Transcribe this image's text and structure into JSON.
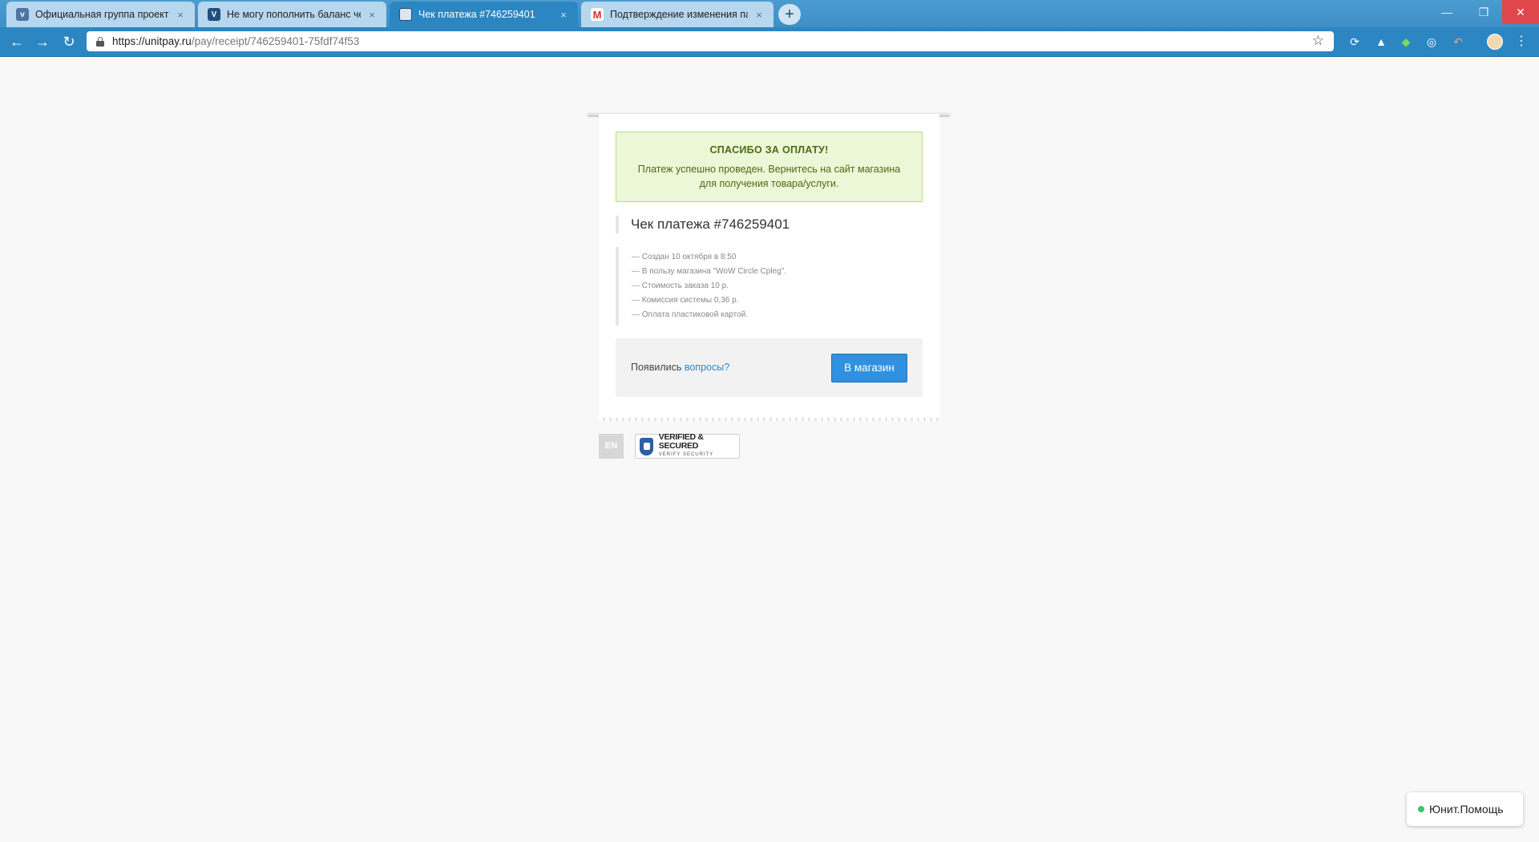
{
  "browser": {
    "tabs": [
      {
        "title": "Официальная группа проекта W",
        "favicon": "vk-icon",
        "favicon_color": "#4c75a3",
        "active": false
      },
      {
        "title": "Не могу пополнить баланс чере",
        "favicon": "forum-icon",
        "favicon_color": "#1f4f7c",
        "active": false
      },
      {
        "title": "Чек платежа #746259401",
        "favicon": "document-icon",
        "favicon_color": "#d9e6f2",
        "active": true
      },
      {
        "title": "Подтверждение изменения пар",
        "favicon": "gmail-icon",
        "favicon_color": "#d93025",
        "active": false
      }
    ],
    "tab_close_glyph": "×",
    "new_tab_glyph": "+",
    "address": {
      "host": "https://unitpay.ru",
      "path": "/pay/receipt/746259401-75fdf74f53"
    }
  },
  "receipt": {
    "success": {
      "title": "СПАСИБО ЗА ОПЛАТУ!",
      "text": "Платеж успешно проведен. Вернитесь на сайт магазина для получения товара/услуги."
    },
    "title": "Чек платежа #746259401",
    "details": [
      "Создан 10 октября в 8:50",
      "В пользу магазина \"WoW Circle Cpleg\".",
      "Стоимость заказа 10 р.",
      "Комиссия системы 0,36 р.",
      "Оплата пластиковой картой."
    ],
    "footer": {
      "question_prefix": "Появились",
      "question_link": "вопросы?",
      "store_button": "В магазин"
    }
  },
  "language_button": "EN",
  "security_badge": {
    "title": "VERIFIED & SECURED",
    "subtitle": "VERIFY SECURITY"
  },
  "help_widget": {
    "label": "Юнит.Помощь",
    "status_color": "#3ec36b"
  },
  "colors": {
    "chrome": "#2c86c2",
    "success_bg": "#ebf7d6",
    "button": "#2f91e0",
    "link": "#2d86c8"
  }
}
